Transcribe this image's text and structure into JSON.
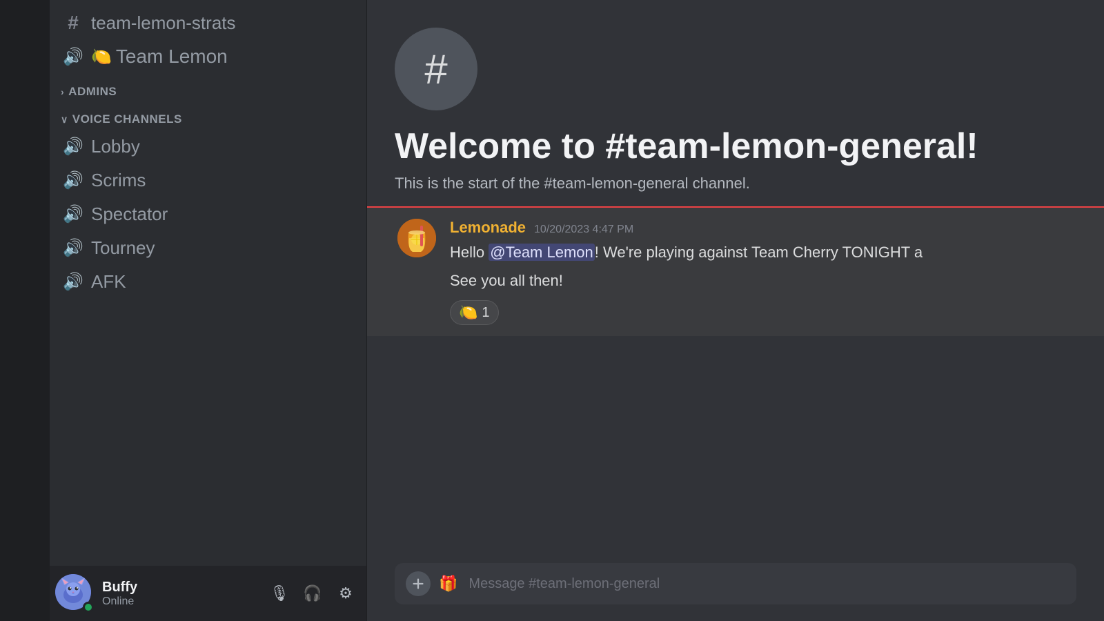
{
  "sidebar": {
    "sections": [
      {
        "name": "text-channels",
        "items": [
          {
            "id": "team-lemon-strats",
            "icon": "#",
            "label": "team-lemon-strats",
            "type": "text"
          }
        ]
      },
      {
        "name": "voice",
        "items": [
          {
            "id": "team-lemon-vc",
            "icon": "🔊",
            "label": "Team Lemon",
            "type": "voice",
            "emoji": "🍋"
          }
        ]
      },
      {
        "name": "admins",
        "label": "ADMINS",
        "collapsed": false
      },
      {
        "name": "voice-channels",
        "label": "VOICE CHANNELS",
        "collapsed": false,
        "items": [
          {
            "id": "lobby",
            "label": "Lobby",
            "type": "voice"
          },
          {
            "id": "scrims",
            "label": "Scrims",
            "type": "voice"
          },
          {
            "id": "spectator",
            "label": "Spectator",
            "type": "voice"
          },
          {
            "id": "tourney",
            "label": "Tourney",
            "type": "voice"
          },
          {
            "id": "afk",
            "label": "AFK",
            "type": "voice"
          }
        ]
      }
    ]
  },
  "current_channel": {
    "name": "team-lemon-general",
    "welcome_title": "Welcome to #team-lemon-general!",
    "welcome_desc": "This is the start of the #team-lemon-general channel."
  },
  "messages": [
    {
      "id": "msg1",
      "author": "Lemonade",
      "author_color": "#f0b132",
      "timestamp": "10/20/2023 4:47 PM",
      "lines": [
        "Hello @Team Lemon! We're playing against Team Cherry TONIGHT a",
        "See you all then!"
      ],
      "mention": "@Team Lemon",
      "reactions": [
        {
          "emoji": "🍋",
          "count": "1"
        }
      ]
    }
  ],
  "user": {
    "name": "Buffy",
    "status": "Online",
    "status_color": "#23a55a"
  },
  "input": {
    "placeholder": "Message #team-lemon-general"
  },
  "controls": {
    "mute_label": "🎙",
    "headset_label": "🎧",
    "settings_label": "⚙"
  }
}
